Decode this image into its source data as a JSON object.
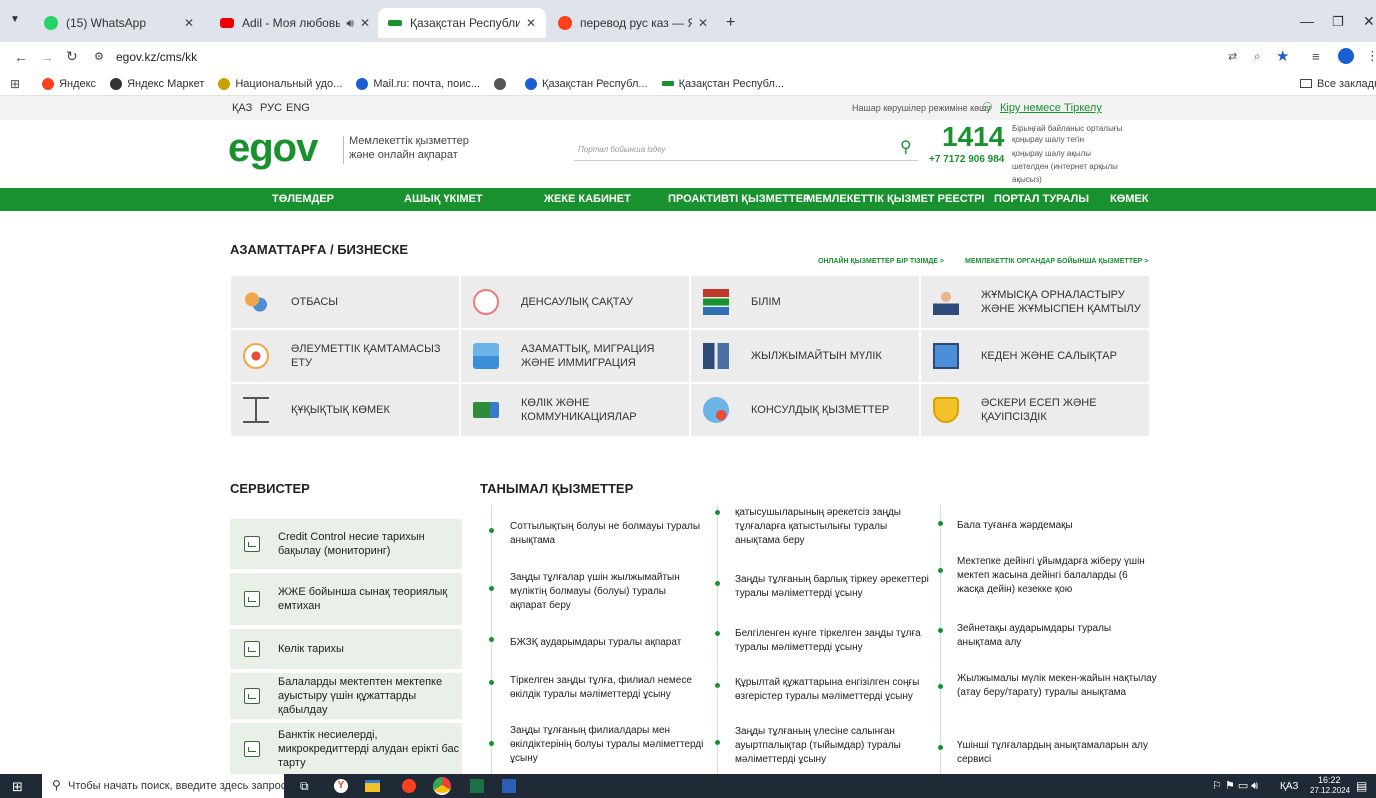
{
  "browser": {
    "tabs": [
      {
        "label": "(15) WhatsApp",
        "icon": "whatsapp-icon"
      },
      {
        "label": "Adil - Моя любовь | Lyric V",
        "icon": "youtube-icon"
      },
      {
        "label": "Қазақстан Республикасының",
        "icon": "egov-icon"
      },
      {
        "label": "перевод рус каз — Яндекс: на",
        "icon": "yandex-icon"
      }
    ],
    "url": "egov.kz/cms/kk",
    "bookmarks": [
      "Яндекс",
      "Яндекс Маркет",
      "Национальный удо...",
      "Mail.ru: почта, поис...",
      "",
      "Қазақстан Республ...",
      "Қазақстан Республ..."
    ],
    "all_bookmarks": "Все закладки"
  },
  "site": {
    "langs": [
      "ҚАЗ",
      "РУС",
      "ENG"
    ],
    "low_vision": "Нашар көрушілер режиміне көшу",
    "login": "Кіру немесе Тіркелу",
    "logo_text": "egov",
    "tagline_1": "Мемлекеттік қызметтер",
    "tagline_2": "және онлайн ақпарат",
    "search_placeholder": "Портал бойынша іздеу",
    "phone_short": "1414",
    "phone_long": "+7 7172 906 984",
    "phone_info_1": "Бірыңғай байланыс орталығы",
    "phone_info_2": "қоңырау шалу тегін",
    "phone_info_3": "қоңырау шалу ақылы",
    "phone_info_4": "шетелден (интернет арқылы",
    "phone_info_5": "ақысыз)",
    "nav": [
      "ТӨЛЕМДЕР",
      "АШЫҚ ҮКІМЕТ",
      "ЖЕКЕ КАБИНЕТ",
      "ПРОАКТИВТІ ҚЫЗМЕТТЕР",
      "МЕМЛЕКЕТТІК ҚЫЗМЕТ РЕЕСТРІ",
      "ПОРТАЛ ТУРАЛЫ",
      "КӨМЕК"
    ],
    "section_title": "АЗАМАТТАРҒА / БИЗНЕСКЕ",
    "link_online": "ОНЛАЙН ҚЫЗМЕТТЕР БІР ТІЗІМДЕ >",
    "link_gov": "МЕМЛЕКЕТТІК ОРГАНДАР БОЙЫНША ҚЫЗМЕТТЕР >",
    "categories": [
      {
        "label": "ОТБАСЫ",
        "icon": "family-icon"
      },
      {
        "label": "ДЕНСАУЛЫҚ САҚТАУ",
        "icon": "health-icon"
      },
      {
        "label": "БІЛІМ",
        "icon": "books-icon"
      },
      {
        "label": "ЖҰМЫСҚА ОРНАЛАСТЫРУ ЖӘНЕ ЖҰМЫСПЕН ҚАМТЫЛУ",
        "icon": "worker-icon"
      },
      {
        "label": "ӘЛЕУМЕТТІК ҚАМТАМАСЫЗ ЕТУ",
        "icon": "social-icon"
      },
      {
        "label": "АЗАМАТТЫҚ, МИГРАЦИЯ ЖӘНЕ ИММИГРАЦИЯ",
        "icon": "migration-icon"
      },
      {
        "label": "ЖЫЛЖЫМАЙТЫН МҮЛІК",
        "icon": "building-icon"
      },
      {
        "label": "КЕДЕН ЖӘНЕ САЛЫҚТАР",
        "icon": "customs-icon"
      },
      {
        "label": "ҚҰҚЫҚТЫҚ КӨМЕК",
        "icon": "scales-icon"
      },
      {
        "label": "КӨЛІК ЖӘНЕ КОММУНИКАЦИЯЛАР",
        "icon": "truck-icon"
      },
      {
        "label": "КОНСУЛДЫҚ ҚЫЗМЕТТЕР",
        "icon": "consular-icon"
      },
      {
        "label": "ӘСКЕРИ ЕСЕП ЖӘНЕ ҚАУІПСІЗДІК",
        "icon": "shield-icon"
      }
    ],
    "services_title": "СЕРВИСТЕР",
    "services": [
      "Credit Control несие тарихын бақылау (мониторинг)",
      "ЖЖЕ бойынша сынақ теориялық емтихан",
      "Көлік тарихы",
      "Балаларды мектептен мектепке ауыстыру үшін құжаттарды қабылдау",
      "Банктік несиелерді, микрокредиттерді алудан ерікті бас тарту"
    ],
    "popular_title": "ТАНЫМАЛ ҚЫЗМЕТТЕР",
    "popular_col1": [
      "Соттылықтың болуы не болмауы туралы анықтама",
      "Заңды тұлғалар үшін жылжымайтын мүліктің болмауы (болуы) туралы ақпарат беру",
      "БЖЗҚ аударымдары туралы ақпарат",
      "Тіркелген заңды тұлға, филиал немесе өкілдік туралы мәліметтерді ұсыну",
      "Заңды тұлғаның филиалдары мен өкілдіктерінің болуы туралы мәліметтерді ұсыну"
    ],
    "popular_col2": [
      "қатысушыларының әрекетсіз заңды тұлғаларға қатыстылығы туралы анықтама беру",
      "Заңды тұлғаның барлық тіркеу әрекеттері туралы мәліметтерді ұсыну",
      "Белгіленген күнге тіркелген заңды тұлға туралы мәліметтерді ұсыну",
      "Құрылтай құжаттарына енгізілген соңғы өзгерістер туралы мәліметтерді ұсыну",
      "Заңды тұлғаның үлесіне салынған ауыртпалықтар (тыйымдар) туралы мәліметтерді ұсыну"
    ],
    "popular_col3": [
      "Бала туғанға жәрдемақы",
      "Мектепке дейінгі ұйымдарға жіберу үшін мектеп жасына дейінгі балаларды (6 жасқа дейін) кезекке қою",
      "Зейнетақы аударымдары туралы анықтама алу",
      "Жылжымалы мүлік мекен-жайын нақтылау (атау беру/тарату) туралы анықтама",
      "Үшінші тұлғалардың анықтамаларын алу сервисі"
    ]
  },
  "taskbar": {
    "search_placeholder": "Чтобы начать поиск, введите здесь запрос",
    "lang": "ҚАЗ",
    "time": "16:22",
    "date": "27.12.2024"
  },
  "colors": {
    "brand_green": "#19912e",
    "tab_bg": "#dfe3eb"
  }
}
